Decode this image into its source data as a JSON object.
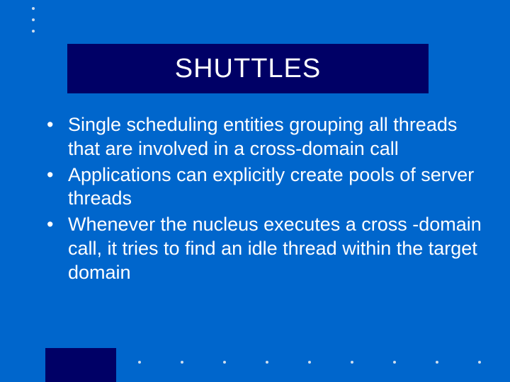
{
  "title": "SHUTTLES",
  "bullets": [
    "Single scheduling entities grouping all threads that are involved in a cross-domain call",
    "Applications can explicitly create pools of server threads",
    "Whenever the nucleus executes a cross -domain call, it tries to find an idle thread within the target domain"
  ]
}
